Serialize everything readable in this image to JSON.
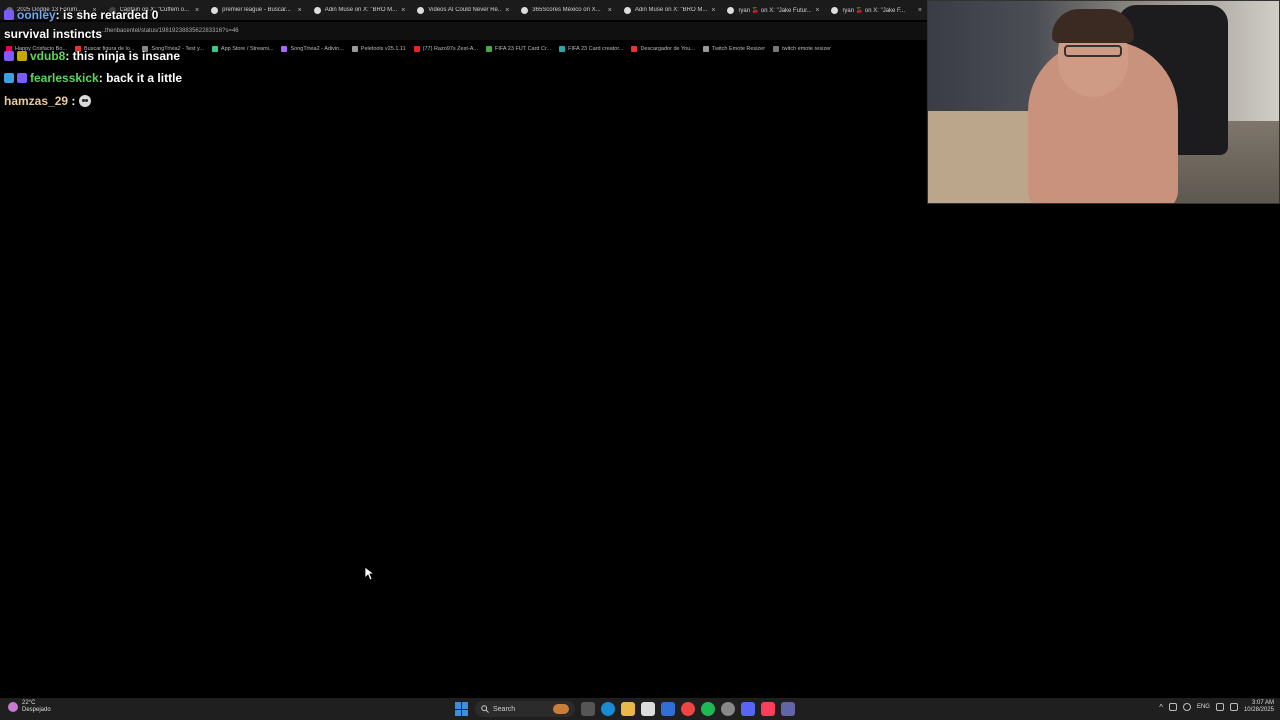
{
  "browser": {
    "tabs": [
      {
        "title": "2025 Dodge 13 Forum...",
        "color": "#6a6a6a"
      },
      {
        "title": "Captain on X: \"Cuffem o...",
        "color": "#444"
      },
      {
        "title": "premier league - Buscar...",
        "color": "#ddd"
      },
      {
        "title": "Adin Muse on X: \"BRO M...",
        "color": "#ddd"
      },
      {
        "title": "Videos AI Could Never Re...",
        "color": "#ddd"
      },
      {
        "title": "365Scores México on X...",
        "color": "#ddd"
      },
      {
        "title": "Adin Muse on X: \"BRO M...",
        "color": "#ddd"
      },
      {
        "title": "ryan 🍒 on X: \"Jake Futur...",
        "color": "#ddd"
      },
      {
        "title": "ryan 🍒 on X: \"Jake F...",
        "color": "#ddd"
      }
    ],
    "url": "...thenbacentel/status/1981923883562283316?s=46",
    "bookmarks": [
      {
        "label": "Happy Crisfacto Bo...",
        "color": "#e05"
      },
      {
        "label": "Buscar figura de lo...",
        "color": "#e33"
      },
      {
        "label": "SongTrivia2 - Test y...",
        "color": "#888"
      },
      {
        "label": "App Store / Streami...",
        "color": "#3c8"
      },
      {
        "label": "SongTrivia2 - Adivin...",
        "color": "#a6f"
      },
      {
        "label": "Peletools v25.1.11",
        "color": "#999"
      },
      {
        "label": "(77) Razo97s Zest-A...",
        "color": "#e22"
      },
      {
        "label": "FIFA 23 FUT Card Cr...",
        "color": "#4a4"
      },
      {
        "label": "FIFA 23 Card creator...",
        "color": "#2aa"
      },
      {
        "label": "Descargador de You...",
        "color": "#e33"
      },
      {
        "label": "Twitch Emote Resizer",
        "color": "#999"
      },
      {
        "label": "twitch emote resizer",
        "color": "#777"
      }
    ]
  },
  "chat": {
    "messages": [
      {
        "user": "oonley",
        "user_color": "#6fa8ff",
        "text": ": is she retarded 0",
        "badge_color": "#7a5cff"
      },
      {
        "user": "",
        "user_color": "#ffffff",
        "text": "survival instincts",
        "badge_color": ""
      },
      {
        "user": "vdub8",
        "user_color": "#5fd35f",
        "text": ": this ninja is insane",
        "badge_color": "#c8a800"
      },
      {
        "user": "fearlesskick",
        "user_color": "#5fd35f",
        "text": ": back it a little",
        "badge_color": "#3aa0e0"
      },
      {
        "user": "hamzas_29",
        "user_color": "#e8c9a0",
        "text": " :",
        "badge_color": ""
      }
    ]
  },
  "taskbar": {
    "weather_temp": "22°C",
    "weather_desc": "Despejado",
    "search_label": "Search",
    "language": "ENG",
    "time": "3:07 AM",
    "date": "10/28/2025"
  }
}
